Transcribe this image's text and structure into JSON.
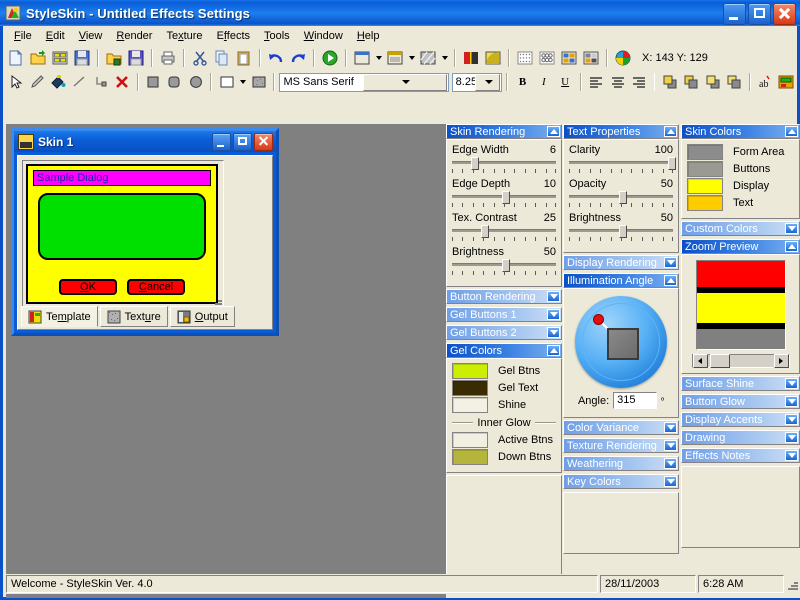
{
  "window": {
    "title": "StyleSkin - Untitled Effects Settings",
    "icon": "styleskin-app-icon",
    "buttons": {
      "minimize": "Minimize",
      "maximize": "Maximize",
      "close": "Close"
    }
  },
  "menu": [
    {
      "label": "File",
      "accel": "F"
    },
    {
      "label": "Edit",
      "accel": "E"
    },
    {
      "label": "View",
      "accel": "V"
    },
    {
      "label": "Render",
      "accel": "R"
    },
    {
      "label": "Texture",
      "accel": "x"
    },
    {
      "label": "Effects",
      "accel": "f"
    },
    {
      "label": "Tools",
      "accel": "T"
    },
    {
      "label": "Window",
      "accel": "W"
    },
    {
      "label": "Help",
      "accel": "H"
    }
  ],
  "toolbar_main": {
    "items": [
      "new-document-icon",
      "open-folder-import-icon",
      "grid-palette-icon",
      "save-disk-icon",
      "sep",
      "open-folder-export-icon",
      "save-as-disk-icon",
      "sep",
      "print-icon",
      "sep",
      "cut-scissors-icon",
      "copy-icon",
      "paste-icon",
      "sep",
      "undo-icon",
      "redo-icon",
      "sep",
      "render-play-icon",
      "sep",
      "window-layout-icon",
      "window-layout-dropdown",
      "window-panel-icon",
      "window-panel-dropdown",
      "texture-swatch-icon",
      "texture-swatch-dropdown",
      "sep",
      "color-split-icon",
      "gradient-sphere-icon",
      "sep",
      "dots-pattern-icon",
      "mesh-pattern-icon",
      "tiles-pattern-icon",
      "mosaic-pattern-icon",
      "sep",
      "color-wheel-icon"
    ],
    "coords": "X: 143 Y: 129"
  },
  "toolbar_draw": {
    "items": [
      "pointer-arrow-icon",
      "pencil-icon",
      "paint-bucket-icon",
      "line-icon",
      "node-edit-icon",
      "delete-x-icon",
      "sep",
      "square-shape-icon",
      "rounded-square-shape-icon",
      "ellipse-shape-icon",
      "sep",
      "fill-style-icon",
      "fill-style-dropdown",
      "texture-fill-icon"
    ],
    "font_name": "MS Sans Serif",
    "font_size": "8.25",
    "bold": "B",
    "italic": "I",
    "underline": "U",
    "align": [
      "align-left-icon",
      "align-center-icon",
      "align-right-icon"
    ],
    "order": [
      "bring-to-front-icon",
      "send-to-back-icon",
      "bring-forward-icon",
      "send-backward-icon"
    ],
    "extras": [
      "text-label-icon",
      "apply-skin-icon"
    ]
  },
  "mdi_window": {
    "title": "Skin 1",
    "icon": "skin-document-icon",
    "buttons": {
      "minimize": "Minimize",
      "maximize": "Maximize",
      "close": "Close"
    },
    "preview": {
      "dialog_title": "Sample Dialog",
      "ok_label": "OK",
      "ok_accel": "O",
      "cancel_label": "Cancel",
      "cancel_accel": "C",
      "colors": {
        "form": "#ffff00",
        "titlebar": "#ff00ff",
        "display": "#00e000",
        "button": "#ff0000",
        "border": "#000000",
        "title_text": "#2222aa"
      }
    },
    "tabs": [
      {
        "label": "Template",
        "accel": "m",
        "icon": "template-icon",
        "active": true
      },
      {
        "label": "Texture",
        "accel": "u",
        "icon": "texture-icon",
        "active": false
      },
      {
        "label": "Output",
        "accel": "O",
        "icon": "output-disk-icon",
        "active": false
      }
    ]
  },
  "panels": {
    "skin_rendering": {
      "title": "Skin Rendering",
      "expanded": true,
      "sliders": [
        {
          "label": "Edge Width",
          "value": 6,
          "percent": 20
        },
        {
          "label": "Edge Depth",
          "value": 10,
          "percent": 50
        },
        {
          "label": "Tex. Contrast",
          "value": 25,
          "percent": 30
        },
        {
          "label": "Brightness",
          "value": 50,
          "percent": 50
        }
      ]
    },
    "collapsed_left": [
      {
        "title": "Button Rendering",
        "expanded": false
      },
      {
        "title": "Gel Buttons 1",
        "expanded": false
      },
      {
        "title": "Gel Buttons 2",
        "expanded": false
      }
    ],
    "gel_colors": {
      "title": "Gel Colors",
      "expanded": true,
      "swatches": [
        {
          "label": "Gel Btns",
          "color": "#ccee00"
        },
        {
          "label": "Gel Text",
          "color": "#3a2c02"
        },
        {
          "label": "Shine",
          "color": "#f3f1e4"
        }
      ],
      "divider": "Inner Glow",
      "glow_swatches": [
        {
          "label": "Active Btns",
          "color": "#f1efe2"
        },
        {
          "label": "Down Btns",
          "color": "#b5b43c"
        }
      ]
    },
    "text_properties": {
      "title": "Text Properties",
      "expanded": true,
      "sliders": [
        {
          "label": "Clarity",
          "value": 100,
          "percent": 98
        },
        {
          "label": "Opacity",
          "value": 50,
          "percent": 50
        },
        {
          "label": "Brightness",
          "value": 50,
          "percent": 50
        }
      ]
    },
    "display_rendering": {
      "title": "Display Rendering",
      "expanded": false
    },
    "illumination_angle": {
      "title": "Illumination Angle",
      "expanded": true,
      "angle_label": "Angle:",
      "angle_value": "315",
      "degree_symbol": "º",
      "dial_handle_color": "#e01010"
    },
    "collapsed_mid": [
      {
        "title": "Color Variance",
        "expanded": false
      },
      {
        "title": "Texture Rendering",
        "expanded": false
      },
      {
        "title": "Weathering",
        "expanded": false
      },
      {
        "title": "Key Colors",
        "expanded": false
      }
    ],
    "skin_colors": {
      "title": "Skin Colors",
      "expanded": true,
      "swatches": [
        {
          "label": "Form Area",
          "color": "#8c8c8c"
        },
        {
          "label": "Buttons",
          "color": "#9a9a92"
        },
        {
          "label": "Display",
          "color": "#ffff00"
        },
        {
          "label": "Text",
          "color": "#ffcc00"
        }
      ]
    },
    "custom_colors": {
      "title": "Custom Colors",
      "expanded": false
    },
    "zoom_preview": {
      "title": "Zoom/ Preview",
      "expanded": true,
      "bands": [
        {
          "color": "#ff0000",
          "height": 26
        },
        {
          "color": "#000000",
          "height": 6
        },
        {
          "color": "#ffff00",
          "height": 30
        },
        {
          "color": "#000000",
          "height": 6
        },
        {
          "color": "#808080",
          "height": 20
        }
      ]
    },
    "collapsed_right": [
      {
        "title": "Surface Shine",
        "expanded": false
      },
      {
        "title": "Button Glow",
        "expanded": false
      },
      {
        "title": "Display Accents",
        "expanded": false
      },
      {
        "title": "Drawing",
        "expanded": false
      },
      {
        "title": "Effects Notes",
        "expanded": false
      }
    ]
  },
  "statusbar": {
    "message": "Welcome - StyleSkin Ver. 4.0",
    "date": "28/11/2003",
    "time": "6:28 AM"
  }
}
